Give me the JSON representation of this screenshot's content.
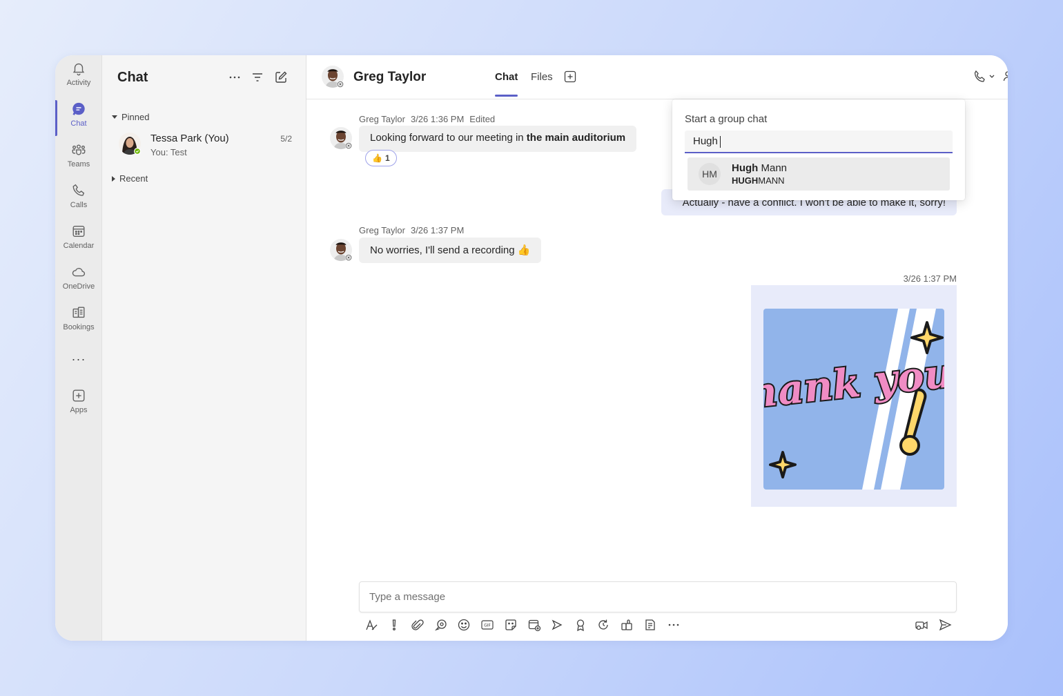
{
  "rail": {
    "items": [
      {
        "label": "Activity",
        "icon": "bell-icon"
      },
      {
        "label": "Chat",
        "icon": "chat-icon"
      },
      {
        "label": "Teams",
        "icon": "teams-icon"
      },
      {
        "label": "Calls",
        "icon": "phone-icon"
      },
      {
        "label": "Calendar",
        "icon": "calendar-icon"
      },
      {
        "label": "OneDrive",
        "icon": "cloud-icon"
      },
      {
        "label": "Bookings",
        "icon": "bookings-icon"
      },
      {
        "label": "Apps",
        "icon": "apps-icon"
      }
    ],
    "more": "···"
  },
  "chatlist": {
    "title": "Chat",
    "pinned_label": "Pinned",
    "recent_label": "Recent",
    "pinned": [
      {
        "name": "Tessa Park (You)",
        "preview": "You: Test",
        "date": "5/2"
      }
    ]
  },
  "header": {
    "name": "Greg Taylor",
    "tabs": [
      {
        "label": "Chat"
      },
      {
        "label": "Files"
      }
    ]
  },
  "messages": [
    {
      "sender": "Greg Taylor",
      "time": "3/26 1:36 PM",
      "edited": "Edited",
      "text_plain": "Looking forward to our meeting in ",
      "text_bold": "the main auditorium",
      "reaction_emoji": "👍",
      "reaction_count": "1"
    },
    {
      "mine": true,
      "text": "Actually - have a conflict. I won't be able to make it, sorry!"
    },
    {
      "sender": "Greg Taylor",
      "time": "3/26 1:37 PM",
      "text": "No worries, I'll send a recording 👍"
    },
    {
      "mine": true,
      "time": "3/26 1:37 PM",
      "sticker": "thank you!"
    }
  ],
  "popup": {
    "title": "Start a group chat",
    "query": "Hugh",
    "suggestion": {
      "initials": "HM",
      "first": "Hugh",
      "last": " Mann",
      "sub_bold": "HUGH",
      "sub_rest": "MANN"
    }
  },
  "composer": {
    "placeholder": "Type a message"
  },
  "colors": {
    "accent": "#5b5fc7",
    "bubble_other": "#f0f0f0",
    "bubble_mine": "#e8ebfa"
  }
}
